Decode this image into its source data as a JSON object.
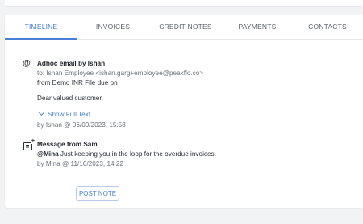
{
  "tabs": [
    {
      "label": "TIMELINE",
      "active": true
    },
    {
      "label": "INVOICES",
      "active": false
    },
    {
      "label": "CREDIT NOTES",
      "active": false
    },
    {
      "label": "PAYMENTS",
      "active": false
    },
    {
      "label": "CONTACTS",
      "active": false
    }
  ],
  "timeline": {
    "email": {
      "icon": "at-sign-icon",
      "title": "Adhoc email by Ishan",
      "to": "to: Ishan Employee <ishan.garg+employee@peakflo.co>",
      "subject": "from Demo INR File due on",
      "greeting": "Dear valued customer,",
      "show_full_text": "Show Full Text",
      "meta": "by Ishan @ 06/09/2023, 15:58"
    },
    "message": {
      "icon": "add-note-icon",
      "title": "Message from Sam",
      "mention": "@Mina",
      "body": " Just keeping you in the loop for the overdue invoices.",
      "meta": "by Mina @ 11/10/2023, 14:22"
    }
  },
  "actions": {
    "post_note": "POST NOTE"
  },
  "colors": {
    "accent": "#4a7fd4",
    "background": "#f2f3f5",
    "card": "#ffffff"
  }
}
